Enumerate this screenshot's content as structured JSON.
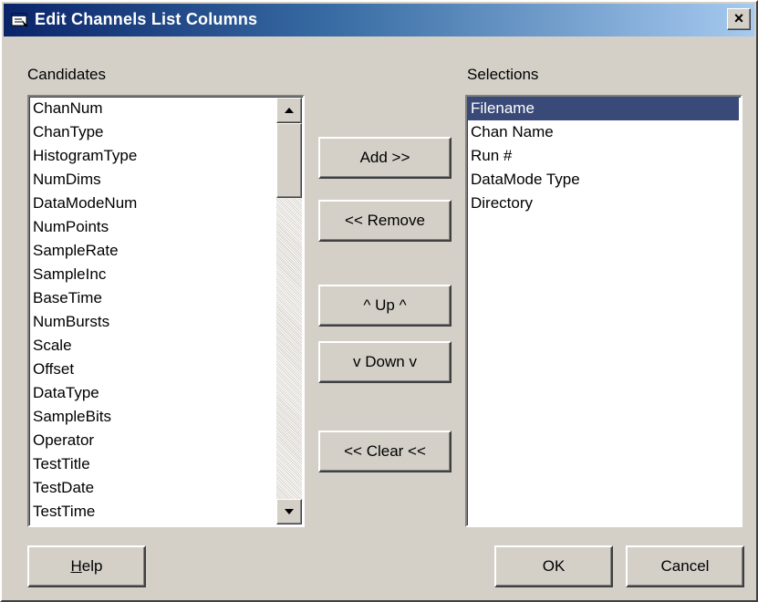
{
  "window": {
    "title": "Edit Channels List Columns",
    "close_label": "×"
  },
  "candidates": {
    "label": "Candidates",
    "items": [
      "ChanNum",
      "ChanType",
      "HistogramType",
      "NumDims",
      "DataModeNum",
      "NumPoints",
      "SampleRate",
      "SampleInc",
      "BaseTime",
      "NumBursts",
      "Scale",
      "Offset",
      "DataType",
      "SampleBits",
      "Operator",
      "TestTitle",
      "TestDate",
      "TestTime"
    ]
  },
  "selections": {
    "label": "Selections",
    "items": [
      "Filename",
      "Chan Name",
      "Run #",
      "DataMode Type",
      "Directory"
    ],
    "selected": "Filename"
  },
  "buttons": {
    "add": "Add >>",
    "remove": "<< Remove",
    "up": "^ Up ^",
    "down": "v Down v",
    "clear": "<< Clear <<",
    "help_mnemonic": "H",
    "help_rest": "elp",
    "ok": "OK",
    "cancel": "Cancel"
  },
  "icons": {
    "title": "window-icon",
    "scroll_up": "arrow-up-icon",
    "scroll_down": "arrow-down-icon"
  },
  "colors": {
    "title_bar_start": "#0a246a",
    "title_bar_end": "#a6caf0",
    "face": "#d4d0c8",
    "selection": "#3a4a78"
  }
}
